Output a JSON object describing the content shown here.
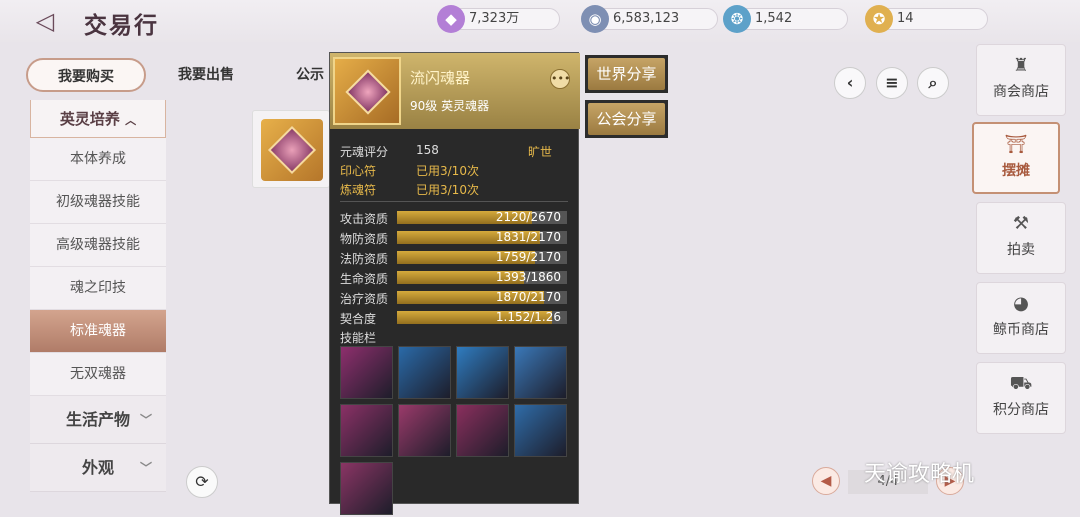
{
  "header": {
    "title": "交易行",
    "back_icon": "back-arrow-icon"
  },
  "currencies": [
    {
      "value": "7,323万",
      "icon": "crystal-icon",
      "color": "#b37fd6"
    },
    {
      "value": "6,583,123",
      "icon": "coin-icon",
      "color": "#7e8fb3"
    },
    {
      "value": "1,542",
      "icon": "shell-icon",
      "color": "#5da1c9"
    },
    {
      "value": "14",
      "icon": "medal-icon",
      "color": "#e0b050"
    }
  ],
  "tabs": [
    {
      "label": "我要购买"
    },
    {
      "label": "我要出售"
    },
    {
      "label": "公示"
    }
  ],
  "sidebar": {
    "open_group": "英灵培养",
    "items": [
      {
        "label": "本体养成"
      },
      {
        "label": "初级魂器技能"
      },
      {
        "label": "高级魂器技能"
      },
      {
        "label": "魂之印技"
      },
      {
        "label": "标准魂器"
      },
      {
        "label": "无双魂器"
      }
    ],
    "groups": [
      {
        "label": "生活产物"
      },
      {
        "label": "外观"
      }
    ]
  },
  "popup": {
    "name": "流闪魂器",
    "level": "90级 英灵魂器",
    "score_label": "元魂评分",
    "score": "158",
    "rarity": "旷世",
    "seal_label": "印心符",
    "seal_value": "已用3/10次",
    "refine_label": "炼魂符",
    "refine_value": "已用3/10次",
    "stats": [
      {
        "label": "攻击资质",
        "text": "2120/2670",
        "fill": 0.794
      },
      {
        "label": "物防资质",
        "text": "1831/2170",
        "fill": 0.844
      },
      {
        "label": "法防资质",
        "text": "1759/2170",
        "fill": 0.811
      },
      {
        "label": "生命资质",
        "text": "1393/1860",
        "fill": 0.749
      },
      {
        "label": "治疗资质",
        "text": "1870/2170",
        "fill": 0.862
      },
      {
        "label": "契合度",
        "text": "1.152/1.26",
        "fill": 0.914
      }
    ],
    "skills_label": "技能栏",
    "skills": [
      {
        "icon": "sword-strike-icon",
        "color": "#8e2f6d"
      },
      {
        "icon": "ice-shield-icon",
        "color": "#2a6aa8"
      },
      {
        "icon": "heal-cross-icon",
        "color": "#2f7cc0"
      },
      {
        "icon": "ice-crystal-icon",
        "color": "#3a78b8"
      },
      {
        "icon": "lightning-slash-icon",
        "color": "#8b3166"
      },
      {
        "icon": "pink-shield-icon",
        "color": "#9a3a6a"
      },
      {
        "icon": "meteor-icon",
        "color": "#8a2f5d"
      },
      {
        "icon": "blue-shield-icon",
        "color": "#2f6ca8"
      },
      {
        "icon": "claw-slash-icon",
        "color": "#8a3564"
      }
    ]
  },
  "share": {
    "world": "世界分享",
    "guild": "公会分享"
  },
  "right_nav": [
    {
      "label": "商会商店"
    },
    {
      "label": "摆摊"
    },
    {
      "label": "拍卖"
    },
    {
      "label": "鲸币商店"
    },
    {
      "label": "积分商店"
    }
  ],
  "pagination": {
    "text": "4/4"
  },
  "watermark": "天谕攻略机"
}
